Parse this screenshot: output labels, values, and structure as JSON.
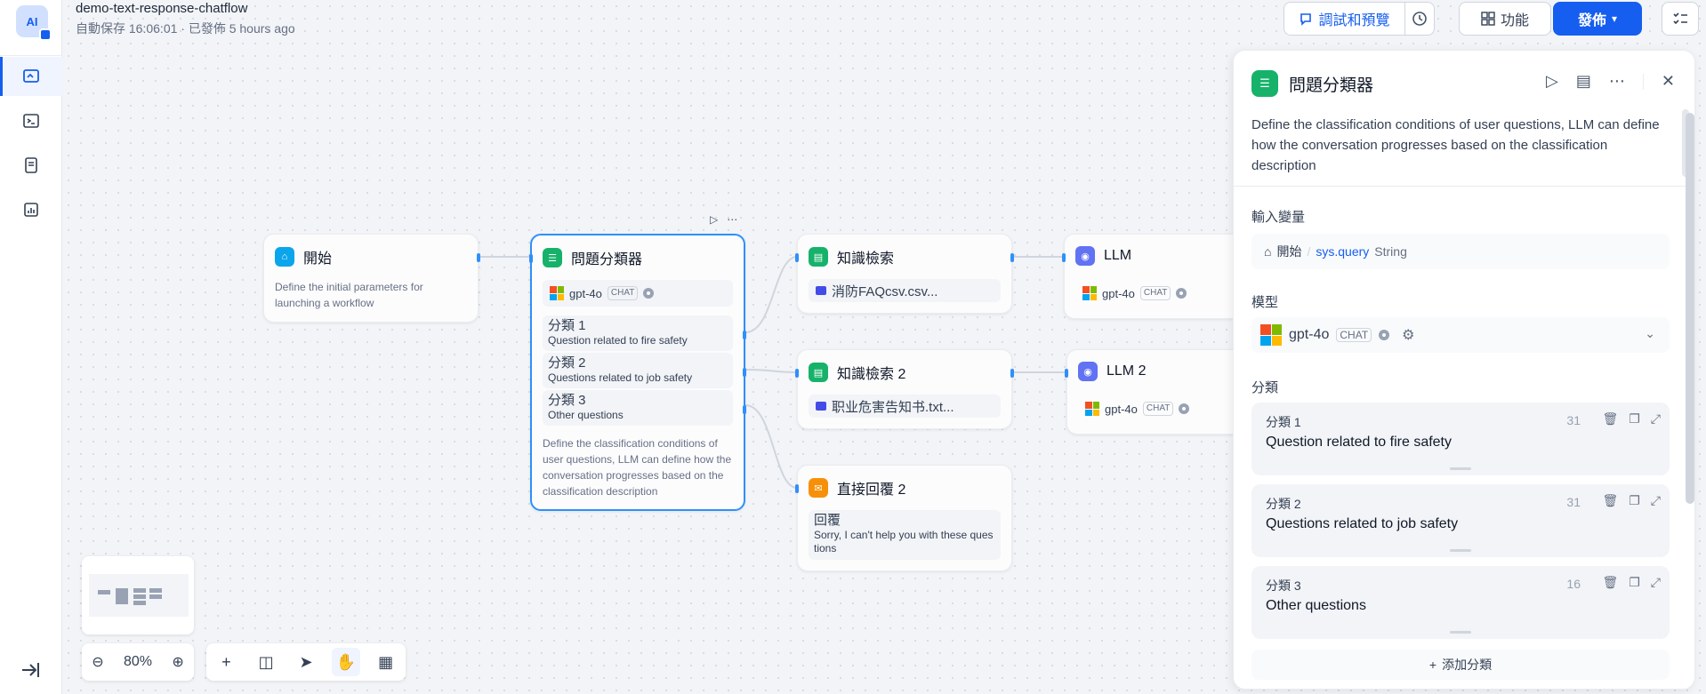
{
  "header": {
    "app_name": "demo-text-response-chatflow",
    "autosave": "自動保存 16:06:01 · 已發佈 5 hours ago",
    "debug_button": "調試和預覽",
    "feature_button": "功能",
    "publish_button": "發佈"
  },
  "sidebar": {
    "logo_text": "AI",
    "items": [
      "workflow-orchestrate",
      "api-access",
      "logs",
      "monitoring"
    ]
  },
  "nodes": {
    "start": {
      "title": "開始",
      "desc": "Define the initial parameters for launching a workflow"
    },
    "classifier": {
      "title": "問題分類器",
      "model": "gpt-4o",
      "model_tag": "CHAT",
      "classes": [
        {
          "name": "分類 1",
          "topic": "Question related to fire safety"
        },
        {
          "name": "分類 2",
          "topic": "Questions related to job safety"
        },
        {
          "name": "分類 3",
          "topic": "Other questions"
        }
      ],
      "desc": "Define the classification conditions of user questions, LLM can define how the conversation progresses based on the classification description"
    },
    "kr1": {
      "title": "知識檢索",
      "dataset": "消防FAQcsv.csv..."
    },
    "kr2": {
      "title": "知識檢索 2",
      "dataset": "职业危害告知书.txt..."
    },
    "answer2": {
      "title": "直接回覆 2",
      "label": "回覆",
      "text": "Sorry, I can't help you with these questions"
    },
    "llm1": {
      "title": "LLM",
      "model": "gpt-4o",
      "model_tag": "CHAT"
    },
    "llm2": {
      "title": "LLM 2",
      "model": "gpt-4o",
      "model_tag": "CHAT"
    }
  },
  "canvas": {
    "zoom": "80%"
  },
  "panel": {
    "title": "問題分類器",
    "desc": "Define the classification conditions of user questions, LLM can define how the conversation progresses based on the classification description",
    "input_label": "輸入變量",
    "input_node": "開始",
    "input_path": "sys.query",
    "input_type": "String",
    "model_label": "模型",
    "model_name": "gpt-4o",
    "model_tag": "CHAT",
    "class_label": "分類",
    "classes": [
      {
        "name": "分類 1",
        "topic": "Question related to fire safety",
        "count": "31"
      },
      {
        "name": "分類 2",
        "topic": "Questions related to job safety",
        "count": "31"
      },
      {
        "name": "分類 3",
        "topic": "Other questions",
        "count": "16"
      }
    ],
    "add_class": "添加分類"
  },
  "colors": {
    "accent": "#155eef",
    "selected_border": "#2e90fa",
    "classifier_green": "#17b26a",
    "llm_indigo": "#6172f3",
    "answer_orange": "#f79009"
  }
}
